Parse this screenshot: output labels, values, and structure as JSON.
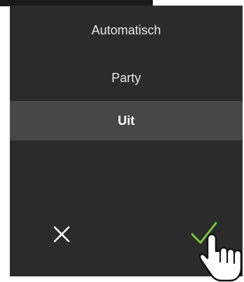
{
  "menu": {
    "options": [
      {
        "label": "Automatisch",
        "selected": false
      },
      {
        "label": "Party",
        "selected": false
      },
      {
        "label": "Uit",
        "selected": true
      }
    ]
  },
  "actions": {
    "cancel_icon": "close-icon",
    "confirm_icon": "check-icon",
    "confirm_color": "#7cc243"
  },
  "colors": {
    "background": "#2b2b2b",
    "selected_row": "#474747",
    "text": "#e6e6e6"
  }
}
